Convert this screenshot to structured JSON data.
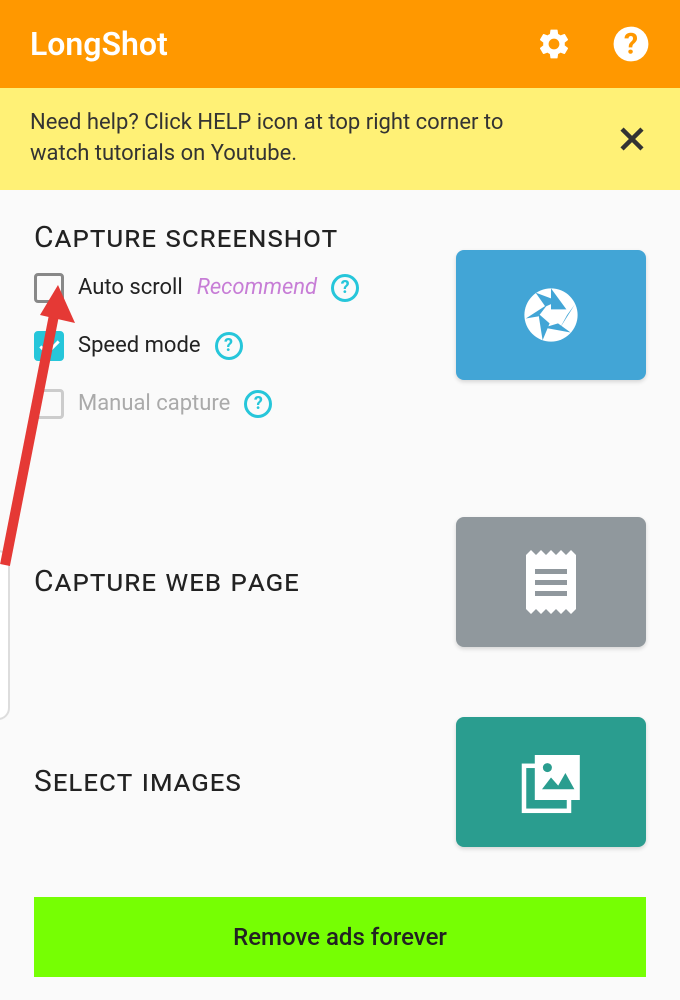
{
  "header": {
    "title": "LongShot"
  },
  "banner": {
    "text": "Need help? Click HELP icon at top right corner to watch tutorials on Youtube."
  },
  "sections": {
    "capture_screenshot": {
      "title": "Capture screenshot",
      "options": {
        "auto_scroll": {
          "label": "Auto scroll",
          "recommend": "Recommend"
        },
        "speed_mode": {
          "label": "Speed mode"
        },
        "manual_capture": {
          "label": "Manual capture"
        }
      }
    },
    "capture_web_page": {
      "title": "Capture web page"
    },
    "select_images": {
      "title": "Select images"
    }
  },
  "remove_ads": {
    "label": "Remove ads forever"
  }
}
